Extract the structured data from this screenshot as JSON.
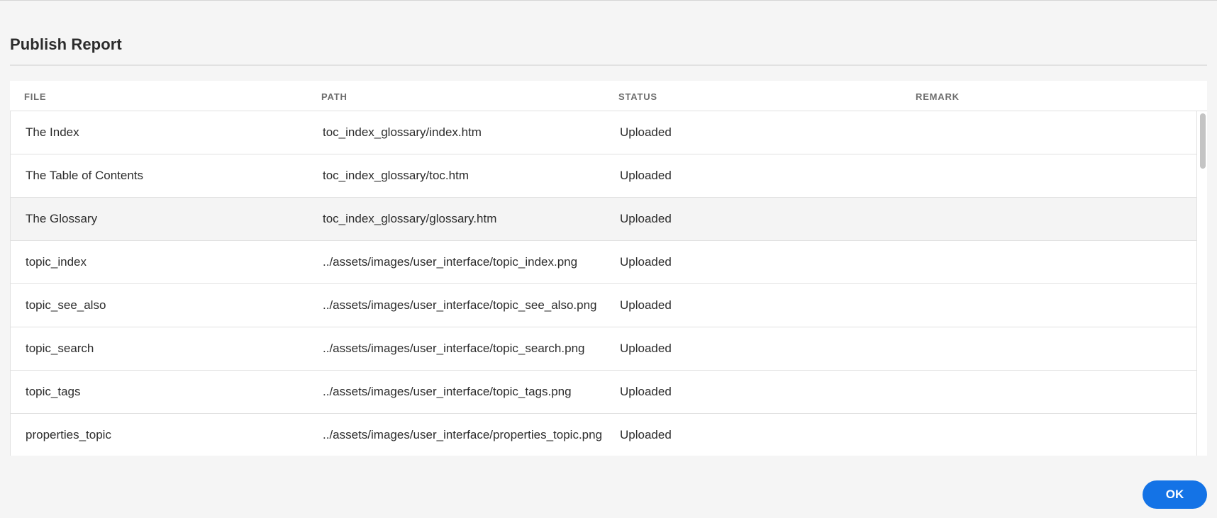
{
  "dialog": {
    "title": "Publish Report",
    "ok_label": "OK"
  },
  "table": {
    "columns": [
      "FILE",
      "PATH",
      "STATUS",
      "REMARK"
    ],
    "rows": [
      {
        "file": "The Index",
        "path": "toc_index_glossary/index.htm",
        "status": "Uploaded",
        "remark": ""
      },
      {
        "file": "The Table of Contents",
        "path": "toc_index_glossary/toc.htm",
        "status": "Uploaded",
        "remark": ""
      },
      {
        "file": "The Glossary",
        "path": "toc_index_glossary/glossary.htm",
        "status": "Uploaded",
        "remark": ""
      },
      {
        "file": "topic_index",
        "path": "../assets/images/user_interface/topic_index.png",
        "status": "Uploaded",
        "remark": ""
      },
      {
        "file": "topic_see_also",
        "path": "../assets/images/user_interface/topic_see_also.png",
        "status": "Uploaded",
        "remark": ""
      },
      {
        "file": "topic_search",
        "path": "../assets/images/user_interface/topic_search.png",
        "status": "Uploaded",
        "remark": ""
      },
      {
        "file": "topic_tags",
        "path": "../assets/images/user_interface/topic_tags.png",
        "status": "Uploaded",
        "remark": ""
      },
      {
        "file": "properties_topic",
        "path": "../assets/images/user_interface/properties_topic.png",
        "status": "Uploaded",
        "remark": ""
      }
    ]
  },
  "colors": {
    "accent": "#1473e6",
    "background": "#f5f5f5",
    "row_hover": "#f4f4f4",
    "divider": "#e1e1e1"
  }
}
